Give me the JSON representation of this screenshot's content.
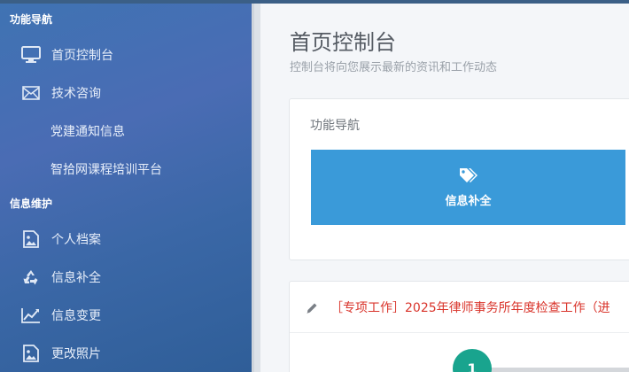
{
  "sidebar": {
    "section1_title": "功能导航",
    "section2_title": "信息维护",
    "items": [
      {
        "label": "首页控制台",
        "icon": "monitor-icon"
      },
      {
        "label": "技术咨询",
        "icon": "envelope-icon"
      },
      {
        "label": "党建通知信息",
        "icon": ""
      },
      {
        "label": "智拾网课程培训平台",
        "icon": ""
      },
      {
        "label": "个人档案",
        "icon": "image-file-icon"
      },
      {
        "label": "信息补全",
        "icon": "recycle-icon"
      },
      {
        "label": "信息变更",
        "icon": "line-chart-icon"
      },
      {
        "label": "更改照片",
        "icon": "image-file-icon"
      }
    ]
  },
  "main": {
    "title": "首页控制台",
    "subtitle": "控制台将向您展示最新的资讯和工作动态",
    "panel_title": "功能导航",
    "tile_label": "信息补全",
    "tile_icon": "tags-icon",
    "notice_text": "［专项工作］2025年律师事务所年度检查工作（进",
    "step_number": "1"
  },
  "colors": {
    "sidebar": "#3f73b3",
    "tile": "#3a9ad9",
    "notice": "#d9342b",
    "step": "#19a48e"
  }
}
